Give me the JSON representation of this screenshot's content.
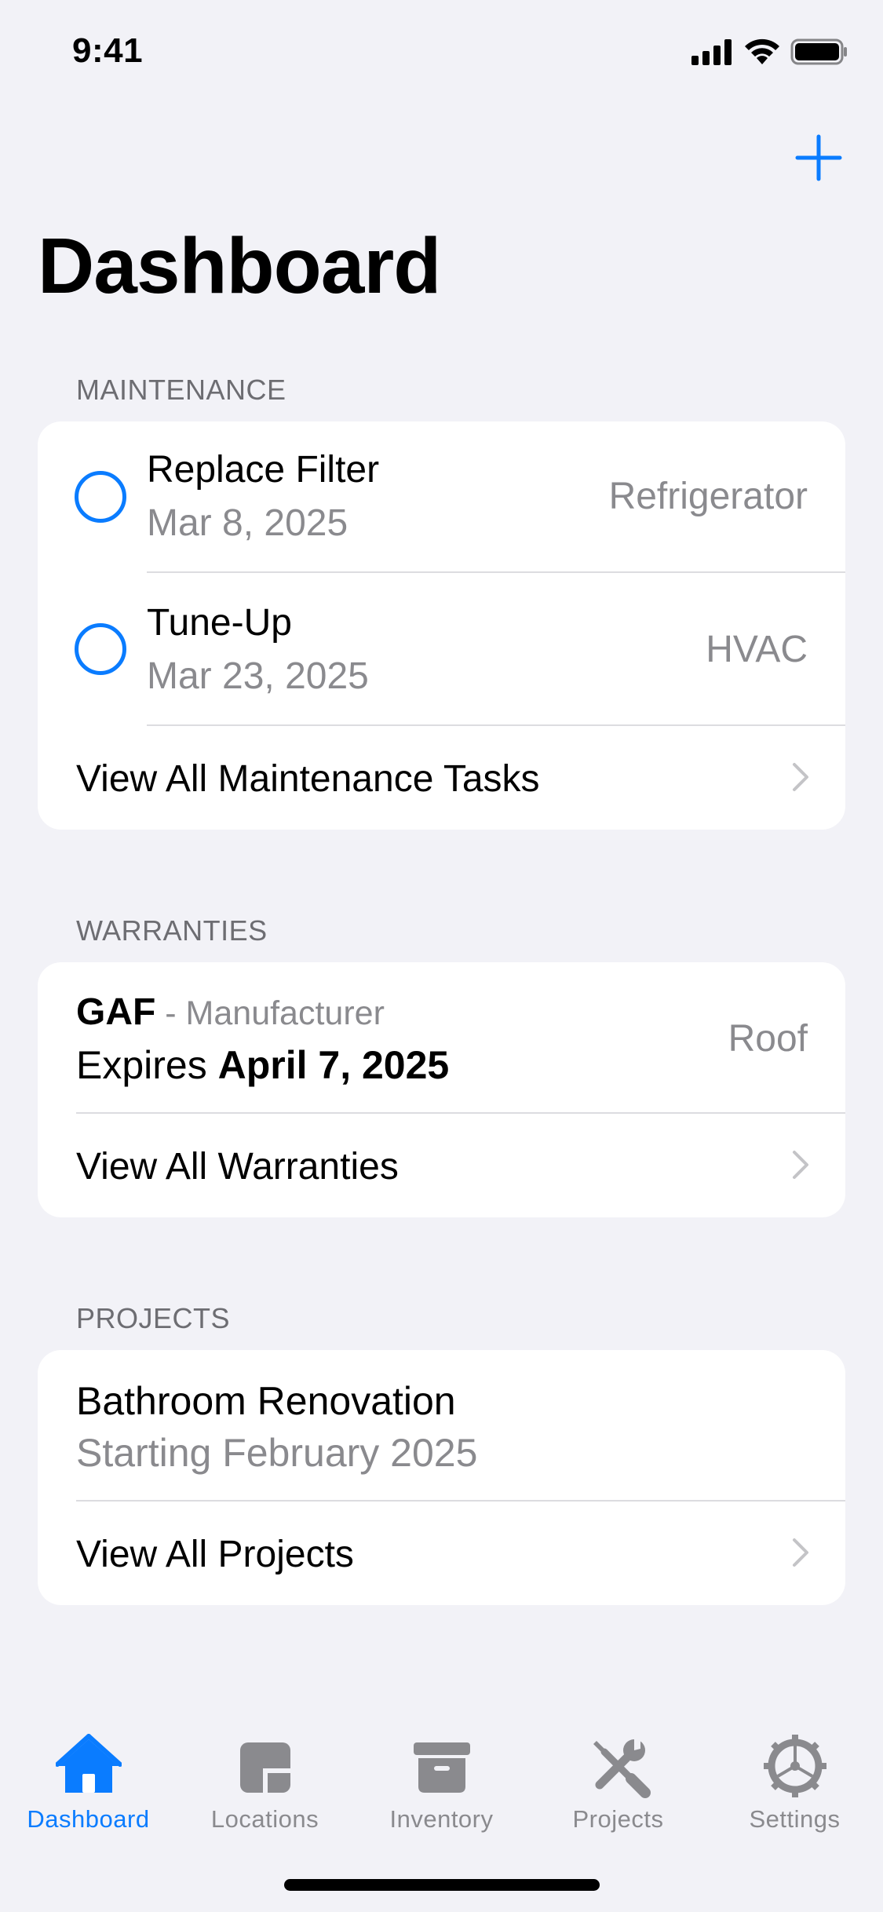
{
  "status_bar": {
    "time": "9:41"
  },
  "nav": {
    "title": "Dashboard",
    "add_icon": "plus-icon"
  },
  "maintenance": {
    "header": "MAINTENANCE",
    "tasks": [
      {
        "title": "Replace Filter",
        "date": "Mar 8, 2025",
        "item": "Refrigerator"
      },
      {
        "title": "Tune-Up",
        "date": "Mar 23, 2025",
        "item": "HVAC"
      }
    ],
    "view_all": "View All Maintenance Tasks"
  },
  "warranties": {
    "header": "WARRANTIES",
    "items": [
      {
        "brand": "GAF",
        "separator": " - ",
        "type": "Manufacturer",
        "expires_label": "Expires ",
        "expires_date": "April 7, 2025",
        "item": "Roof"
      }
    ],
    "view_all": "View All Warranties"
  },
  "projects": {
    "header": "PROJECTS",
    "items": [
      {
        "title": "Bathroom Renovation",
        "subtitle": "Starting February 2025"
      }
    ],
    "view_all": "View All Projects"
  },
  "tabs": [
    {
      "label": "Dashboard",
      "icon": "house-icon",
      "active": true
    },
    {
      "label": "Locations",
      "icon": "locations-icon",
      "active": false
    },
    {
      "label": "Inventory",
      "icon": "archive-box-icon",
      "active": false
    },
    {
      "label": "Projects",
      "icon": "wrench-screwdriver-icon",
      "active": false
    },
    {
      "label": "Settings",
      "icon": "gear-icon",
      "active": false
    }
  ],
  "colors": {
    "accent": "#0a7cff",
    "secondary_text": "#8a8a8e",
    "background": "#f2f2f7"
  }
}
